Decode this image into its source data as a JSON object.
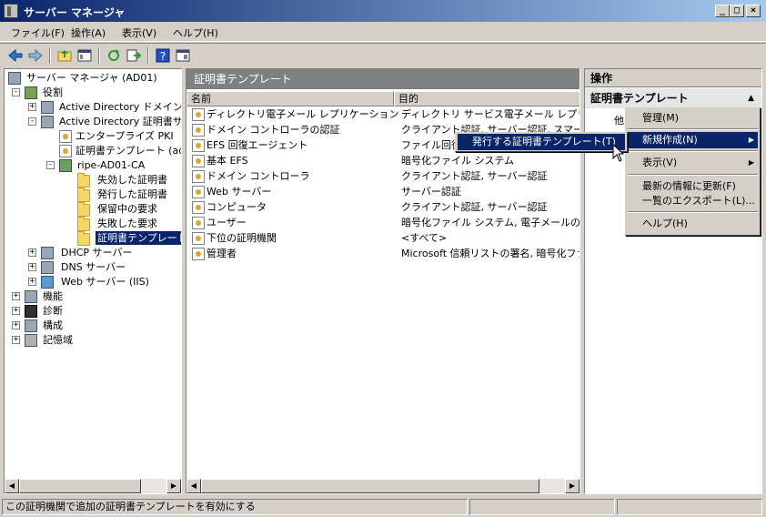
{
  "window": {
    "title": "サーバー マネージャ"
  },
  "menu": [
    "ファイル(F)",
    "操作(A)",
    "表示(V)",
    "ヘルプ(H)"
  ],
  "tree": {
    "root": "サーバー マネージャ (AD01)",
    "roles": "役割",
    "ad_domain": "Active Directory ドメイン サ",
    "ad_cs": "Active Directory 証明書サ",
    "enterprise_pki": "エンタープライズ PKI",
    "cert_templates_ad": "証明書テンプレート (ad",
    "ca": "ripe-AD01-CA",
    "revoked": "失効した証明書",
    "issued": "発行した証明書",
    "pending": "保留中の要求",
    "failed": "失敗した要求",
    "templates": "証明書テンプレート",
    "dhcp": "DHCP サーバー",
    "dns": "DNS サーバー",
    "web": "Web サーバー (IIS)",
    "features": "機能",
    "diagnostics": "診断",
    "config": "構成",
    "storage": "記憶域"
  },
  "middle": {
    "header": "証明書テンプレート",
    "col_name": "名前",
    "col_purpose": "目的",
    "rows": [
      {
        "name": "ディレクトリ電子メール レプリケーション",
        "purpose": "ディレクトリ サービス電子メール レプリケーシ"
      },
      {
        "name": "ドメイン コントローラの認証",
        "purpose": "クライアント認証, サーバー認証, スマート カ"
      },
      {
        "name": "EFS 回復エージェント",
        "purpose": "ファイル回復"
      },
      {
        "name": "基本 EFS",
        "purpose": "暗号化ファイル システム"
      },
      {
        "name": "ドメイン コントローラ",
        "purpose": "クライアント認証, サーバー認証"
      },
      {
        "name": "Web サーバー",
        "purpose": "サーバー認証"
      },
      {
        "name": "コンピュータ",
        "purpose": "クライアント認証, サーバー認証"
      },
      {
        "name": "ユーザー",
        "purpose": "暗号化ファイル システム, 電子メールの保譜"
      },
      {
        "name": "下位の証明機関",
        "purpose": "<すべて>"
      },
      {
        "name": "管理者",
        "purpose": "Microsoft 信頼リストの署名, 暗号化ファイ"
      }
    ]
  },
  "actions": {
    "title": "操作",
    "subtitle": "証明書テンプレート",
    "other": "他"
  },
  "context_main": {
    "items": [
      "管理(M)",
      "新規作成(N)",
      "表示(V)",
      "最新の情報に更新(F)",
      "一覧のエクスポート(L)...",
      "ヘルプ(H)"
    ]
  },
  "context_sub": {
    "item": "発行する証明書テンプレート(T)"
  },
  "status": {
    "text": "この証明機関で追加の証明書テンプレートを有効にする"
  }
}
